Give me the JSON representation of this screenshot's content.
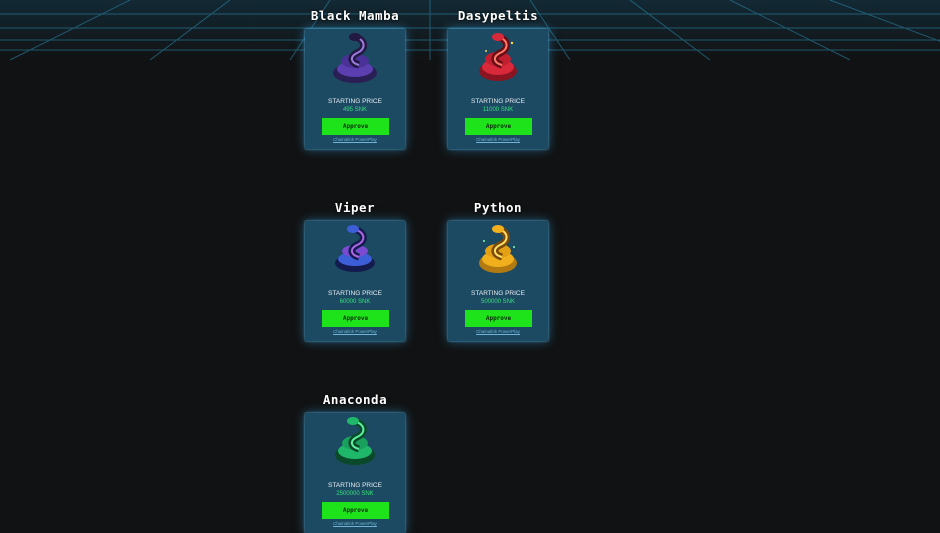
{
  "labels": {
    "starting_price": "STARTING PRICE",
    "approve": "Approve",
    "chart_link": "Chainalink PowerPlay"
  },
  "snakes": [
    {
      "name": "Black Mamba",
      "price": "495 SNK",
      "colors": {
        "body": "#5b3fb0",
        "belly": "#9a7be0",
        "dark": "#231840"
      }
    },
    {
      "name": "Dasypeltis",
      "price": "11000 SNK",
      "colors": {
        "body": "#d8293a",
        "belly": "#ff7b6b",
        "dark": "#6a0d16"
      }
    },
    {
      "name": "Viper",
      "price": "60000 SNK",
      "colors": {
        "body": "#3c5fd8",
        "belly": "#b266e6",
        "dark": "#141c4e"
      }
    },
    {
      "name": "Python",
      "price": "500000 SNK",
      "colors": {
        "body": "#f0b01e",
        "belly": "#ffe06a",
        "dark": "#7a4a08"
      }
    },
    {
      "name": "Anaconda",
      "price": "2500000 SNK",
      "colors": {
        "body": "#1fb86a",
        "belly": "#5ef0a0",
        "dark": "#0a4a2a"
      }
    }
  ],
  "theme": {
    "card_bg": "#1c4a62",
    "approve_bg": "#1fe31a",
    "price_color": "#37e07a"
  }
}
